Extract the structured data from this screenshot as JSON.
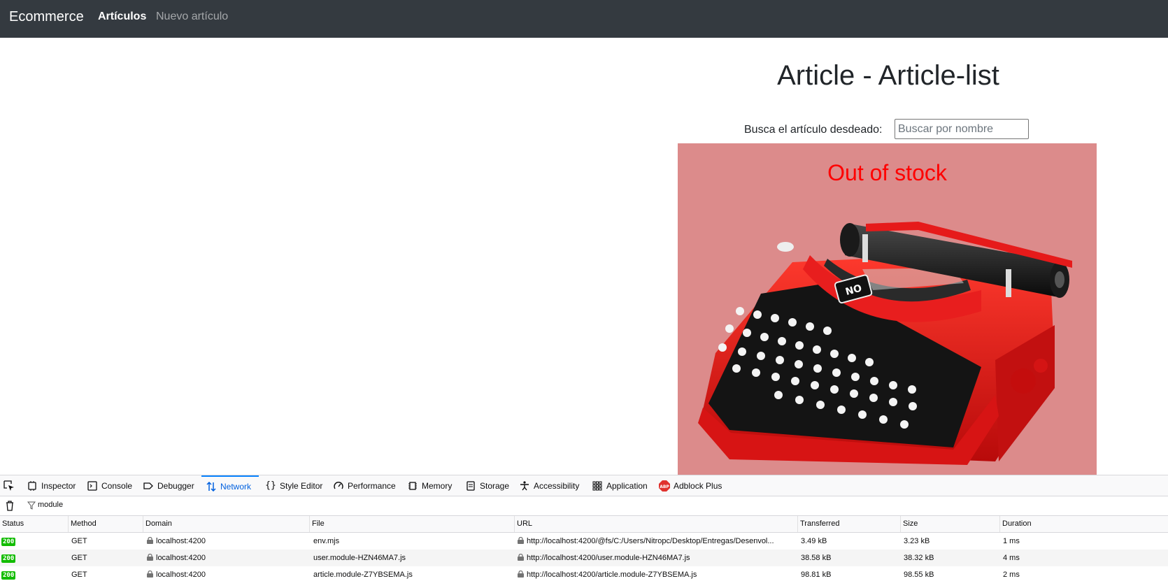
{
  "navbar": {
    "brand": "Ecommerce",
    "links": [
      {
        "label": "Artículos",
        "active": true
      },
      {
        "label": "Nuevo artículo",
        "active": false
      }
    ]
  },
  "main": {
    "title": "Article - Article-list",
    "search": {
      "label": "Busca el artículo desdeado:",
      "placeholder": "Buscar por nombre",
      "value": ""
    },
    "card": {
      "status": "Out of stock",
      "image_icon": "typewriter-image",
      "status_color": "#ff0000",
      "background": "#dc8b8b"
    }
  },
  "devtools": {
    "tabs": [
      {
        "label": "Inspector",
        "icon": "inspector-icon"
      },
      {
        "label": "Console",
        "icon": "console-icon"
      },
      {
        "label": "Debugger",
        "icon": "debugger-icon"
      },
      {
        "label": "Network",
        "icon": "network-icon",
        "active": true
      },
      {
        "label": "Style Editor",
        "icon": "style-editor-icon"
      },
      {
        "label": "Performance",
        "icon": "performance-icon"
      },
      {
        "label": "Memory",
        "icon": "memory-icon"
      },
      {
        "label": "Storage",
        "icon": "storage-icon"
      },
      {
        "label": "Accessibility",
        "icon": "accessibility-icon"
      },
      {
        "label": "Application",
        "icon": "application-icon"
      },
      {
        "label": "Adblock Plus",
        "icon": "adblock-plus-icon"
      }
    ],
    "filter": "module",
    "columns": [
      "Status",
      "Method",
      "Domain",
      "File",
      "URL",
      "Transferred",
      "Size",
      "Duration"
    ],
    "rows": [
      {
        "status": "200",
        "method": "GET",
        "domain": "localhost:4200",
        "file": "env.mjs",
        "url": "http://localhost:4200/@fs/C:/Users/Nitropc/Desktop/Entregas/Desenvol...",
        "transferred": "3.49 kB",
        "size": "3.23 kB",
        "duration": "1 ms"
      },
      {
        "status": "200",
        "method": "GET",
        "domain": "localhost:4200",
        "file": "user.module-HZN46MA7.js",
        "url": "http://localhost:4200/user.module-HZN46MA7.js",
        "transferred": "38.58 kB",
        "size": "38.32 kB",
        "duration": "4 ms"
      },
      {
        "status": "200",
        "method": "GET",
        "domain": "localhost:4200",
        "file": "article.module-Z7YBSEMA.js",
        "url": "http://localhost:4200/article.module-Z7YBSEMA.js",
        "transferred": "98.81 kB",
        "size": "98.55 kB",
        "duration": "2 ms"
      }
    ]
  }
}
